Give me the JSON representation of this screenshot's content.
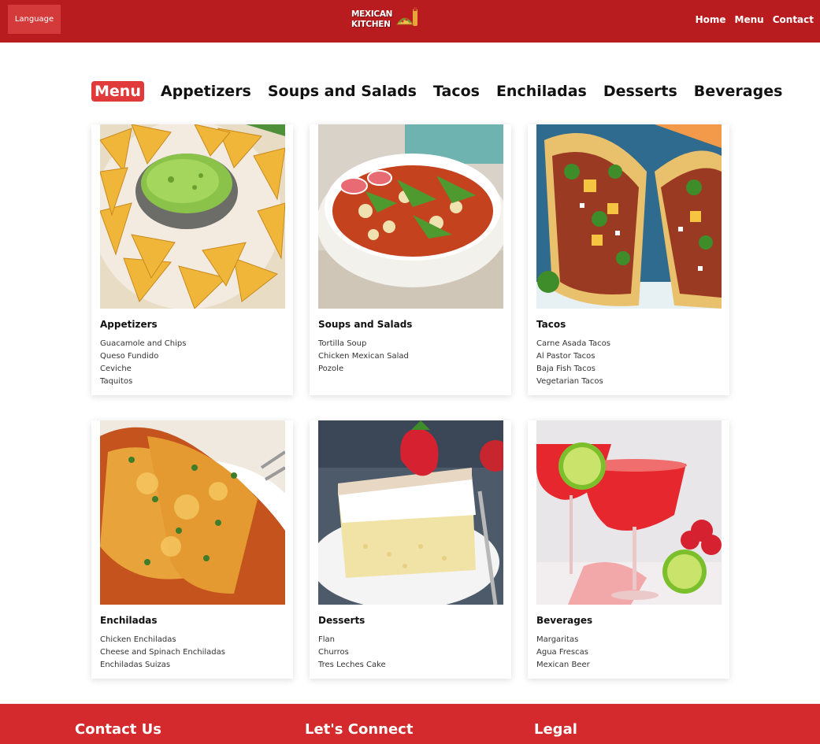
{
  "header": {
    "language_label": "Language",
    "logo_line1": "MEXICAN",
    "logo_line2": "KITCHEN",
    "nav": [
      "Home",
      "Menu",
      "Contact"
    ],
    "bg_color": "#b81c1f"
  },
  "menu_tabs": {
    "active": "Menu",
    "items": [
      "Menu",
      "Appetizers",
      "Soups and Salads",
      "Tacos",
      "Enchiladas",
      "Desserts",
      "Beverages"
    ]
  },
  "cards": [
    {
      "title": "Appetizers",
      "image": "guacamole-chips-photo",
      "items": [
        "Guacamole and Chips",
        "Queso Fundido",
        "Ceviche",
        "Taquitos"
      ]
    },
    {
      "title": "Soups and Salads",
      "image": "pozole-soup-photo",
      "items": [
        "Tortilla Soup",
        "Chicken Mexican Salad",
        "Pozole"
      ]
    },
    {
      "title": "Tacos",
      "image": "tacos-photo",
      "items": [
        "Carne Asada Tacos",
        "Al Pastor Tacos",
        "Baja Fish Tacos",
        "Vegetarian Tacos"
      ]
    },
    {
      "title": "Enchiladas",
      "image": "enchiladas-photo",
      "items": [
        "Chicken Enchiladas",
        "Cheese and Spinach Enchiladas",
        "Enchiladas Suizas"
      ]
    },
    {
      "title": "Desserts",
      "image": "tres-leches-cake-photo",
      "items": [
        "Flan",
        "Churros",
        "Tres Leches Cake"
      ]
    },
    {
      "title": "Beverages",
      "image": "margaritas-photo",
      "items": [
        "Margaritas",
        "Agua Frescas",
        "Mexican Beer"
      ]
    }
  ],
  "footer": {
    "headings": [
      "Contact Us",
      "Let's Connect",
      "Legal"
    ],
    "bg_color": "#d42a2d"
  }
}
